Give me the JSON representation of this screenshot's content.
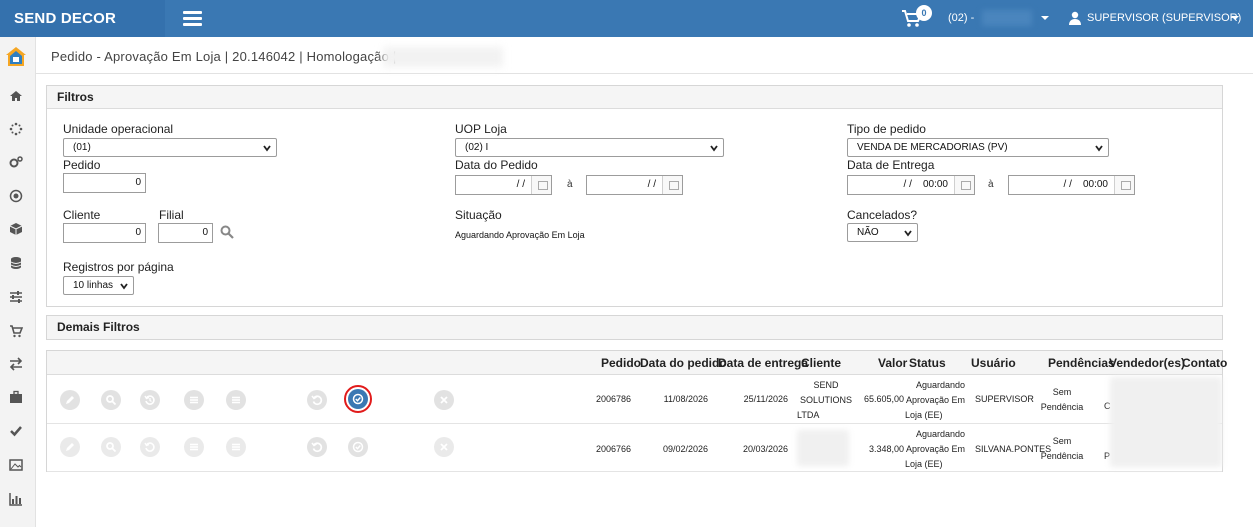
{
  "app": {
    "title": "SEND DECOR"
  },
  "header": {
    "cart_count": "0",
    "store_label": "(02) -",
    "user_label": "SUPERVISOR (SUPERVISOR)"
  },
  "sidebar": {
    "items": [
      "home-icon",
      "spinner-icon",
      "cogs-icon",
      "target-icon",
      "cube-icon",
      "database-icon",
      "sliders-icon",
      "cart-icon",
      "exchange-icon",
      "briefcase-icon",
      "check-icon",
      "image-icon",
      "bar-chart-icon"
    ]
  },
  "breadcrumb": {
    "text": "Pedido - Aprovação Em Loja | 20.146042 | Homologação |"
  },
  "filters": {
    "title": "Filtros",
    "unidade_label": "Unidade operacional",
    "unidade_value": "(01)",
    "uop_label": "UOP Loja",
    "uop_value": "(02) I",
    "tipo_label": "Tipo de pedido",
    "tipo_value": "VENDA DE MERCADORIAS (PV)",
    "pedido_label": "Pedido",
    "pedido_value": "0",
    "data_pedido_label": "Data do Pedido",
    "data_pedido_from": "/ /",
    "data_pedido_to": "/ /",
    "ate": "à",
    "data_entrega_label": "Data de Entrega",
    "data_entrega_from": "/ /    00:00",
    "data_entrega_to": "/ /    00:00",
    "cliente_label": "Cliente",
    "cliente_value": "0",
    "filial_label": "Filial",
    "filial_value": "0",
    "situacao_label": "Situação",
    "situacao_value": "Aguardando Aprovação Em Loja",
    "cancelados_label": "Cancelados?",
    "cancelados_value": "NÃO",
    "registros_label": "Registros por página",
    "registros_value": "10 linhas"
  },
  "demais": {
    "title": "Demais Filtros"
  },
  "table": {
    "columns": [
      "Pedido",
      "Data do pedido",
      "Data de entrega",
      "Cliente",
      "Valor",
      "Status",
      "Usuário",
      "Pendências",
      "Vendedor(es)",
      "Contato"
    ],
    "rows": [
      {
        "pedido": "2006786",
        "data_pedido": "11/08/2026",
        "data_entrega": "25/11/2026",
        "cliente": [
          "SEND",
          "SOLUTIONS",
          "LTDA"
        ],
        "valor": "65.605,00",
        "status": [
          "Aguardando",
          "Aprovação Em",
          "Loja (EE)"
        ],
        "usuario": "SUPERVISOR",
        "pendencias": [
          "Sem",
          "Pendência"
        ],
        "vendedor_frag": "C"
      },
      {
        "pedido": "2006766",
        "data_pedido": "09/02/2026",
        "data_entrega": "20/03/2026",
        "cliente": [],
        "valor": "3.348,00",
        "status": [
          "Aguardando",
          "Aprovação Em",
          "Loja (EE)"
        ],
        "usuario": "SILVANA.PONTES",
        "pendencias": [
          "Sem",
          "Pendência"
        ],
        "vendedor_frag": "P"
      }
    ]
  },
  "colors": {
    "primary": "#3a78b3",
    "highlight_ring": "#e11b1b"
  }
}
